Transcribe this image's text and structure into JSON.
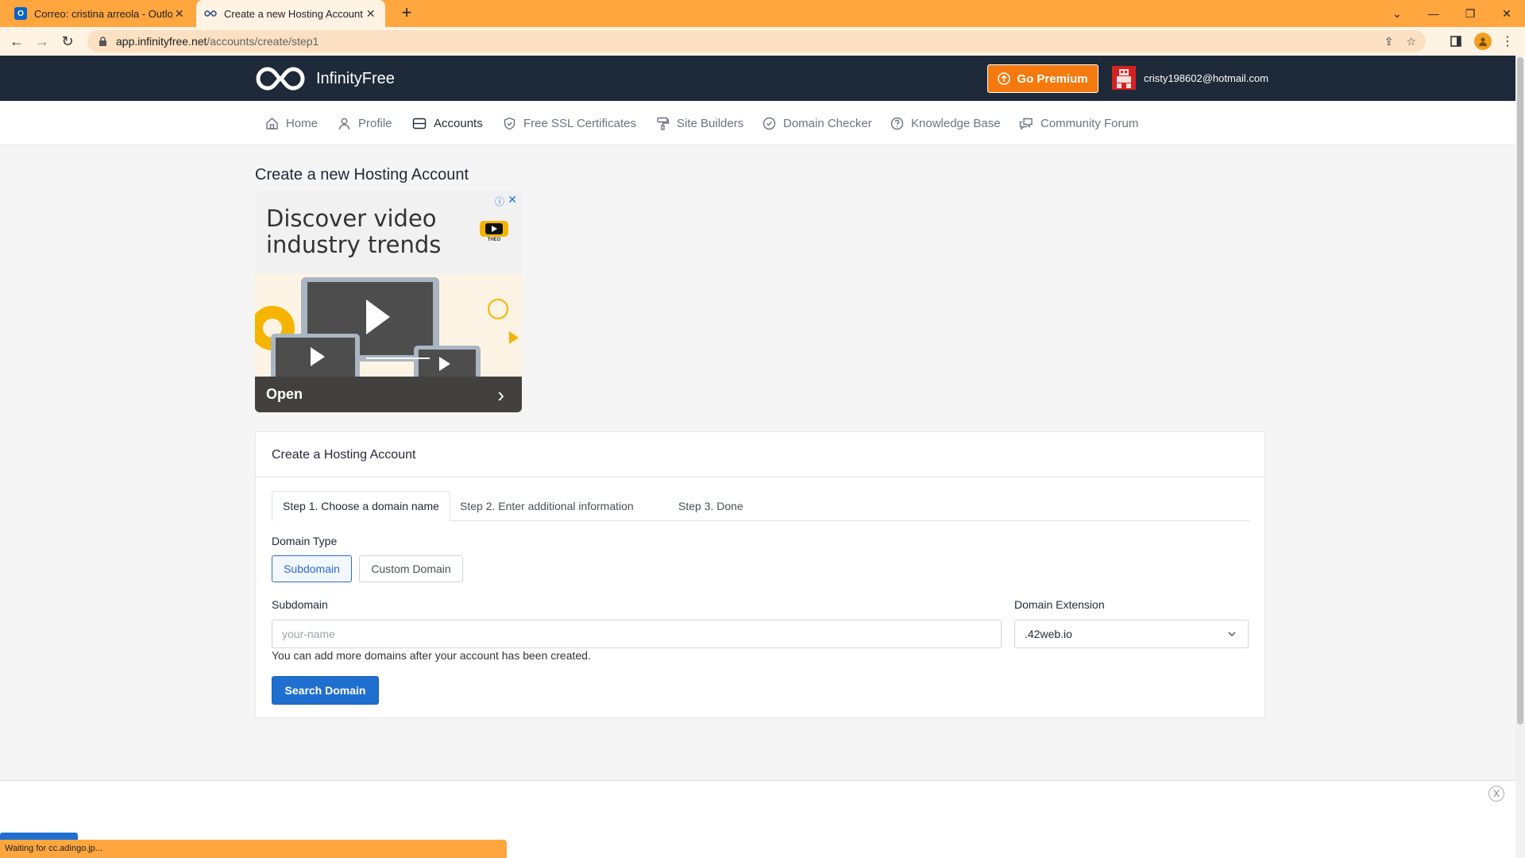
{
  "browser": {
    "tabs": [
      {
        "title": "Correo: cristina arreola - Outlook",
        "active": false
      },
      {
        "title": "Create a new Hosting Account - I",
        "active": true
      }
    ],
    "url_host": "app.infinityfree.net",
    "url_path": "/accounts/create/step1",
    "status_text": "Waiting for cc.adingo.jp..."
  },
  "site": {
    "brand": "InfinityFree",
    "premium_label": "Go Premium",
    "user_email": "cristy198602@hotmail.com",
    "nav": [
      {
        "label": "Home",
        "icon": "home-icon"
      },
      {
        "label": "Profile",
        "icon": "user-icon"
      },
      {
        "label": "Accounts",
        "icon": "accounts-icon"
      },
      {
        "label": "Free SSL Certificates",
        "icon": "shield-icon"
      },
      {
        "label": "Site Builders",
        "icon": "paint-roller-icon"
      },
      {
        "label": "Domain Checker",
        "icon": "check-circle-icon"
      },
      {
        "label": "Knowledge Base",
        "icon": "help-circle-icon"
      },
      {
        "label": "Community Forum",
        "icon": "chat-icon"
      }
    ],
    "active_nav": "Accounts"
  },
  "page": {
    "title": "Create a new Hosting Account"
  },
  "ad": {
    "headline_line1": "Discover video",
    "headline_line2": "industry trends",
    "brand": "THEO",
    "cta": "Open"
  },
  "card": {
    "title": "Create a Hosting Account",
    "steps": [
      "Step 1. Choose a domain name",
      "Step 2. Enter additional information",
      "Step 3. Done"
    ],
    "domain_type_label": "Domain Type",
    "domain_type_options": [
      "Subdomain",
      "Custom Domain"
    ],
    "selected_domain_type": "Subdomain",
    "subdomain_label": "Subdomain",
    "subdomain_placeholder": "your-name",
    "subdomain_value": "",
    "extension_label": "Domain Extension",
    "extension_value": ".42web.io",
    "help_text": "You can add more domains after your account has been created.",
    "search_button": "Search Domain"
  },
  "colors": {
    "chrome_orange": "#ffa63f",
    "header_dark": "#1e2939",
    "premium_orange": "#f47a0f",
    "primary_blue": "#1f6fd0"
  }
}
